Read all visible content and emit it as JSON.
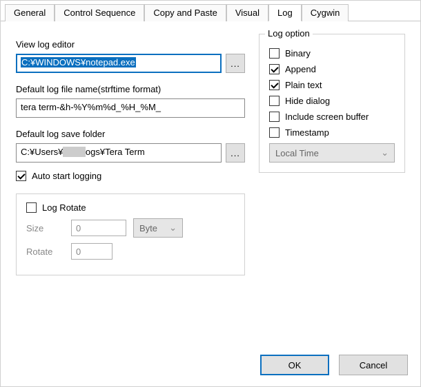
{
  "tabs": {
    "items": [
      "General",
      "Control Sequence",
      "Copy and Paste",
      "Visual",
      "Log",
      "Cygwin"
    ],
    "active": "Log"
  },
  "left": {
    "view_log_editor_label": "View log editor",
    "view_log_editor_value": "C:¥WINDOWS¥notepad.exe",
    "browse": "...",
    "default_log_file_label": "Default log file name(strftime format)",
    "default_log_file_value": "tera term-&h-%Y%m%d_%H_%M_",
    "default_log_save_folder_label": "Default log save folder",
    "default_log_save_folder_value_pre": "C:¥Users¥",
    "default_log_save_folder_value_mid": "xxxxx",
    "default_log_save_folder_value_post": "ogs¥Tera Term",
    "auto_start_logging_label": "Auto start logging",
    "auto_start_logging_checked": true,
    "log_rotate": {
      "label": "Log Rotate",
      "checked": false,
      "size_label": "Size",
      "size_value": "0",
      "size_unit": "Byte",
      "rotate_label": "Rotate",
      "rotate_value": "0"
    }
  },
  "right": {
    "group_label": "Log option",
    "options": [
      {
        "label": "Binary",
        "checked": false
      },
      {
        "label": "Append",
        "checked": true
      },
      {
        "label": "Plain text",
        "checked": true
      },
      {
        "label": "Hide dialog",
        "checked": false
      },
      {
        "label": "Include screen buffer",
        "checked": false
      },
      {
        "label": "Timestamp",
        "checked": false
      }
    ],
    "timestamp_type": "Local Time"
  },
  "buttons": {
    "ok": "OK",
    "cancel": "Cancel"
  }
}
